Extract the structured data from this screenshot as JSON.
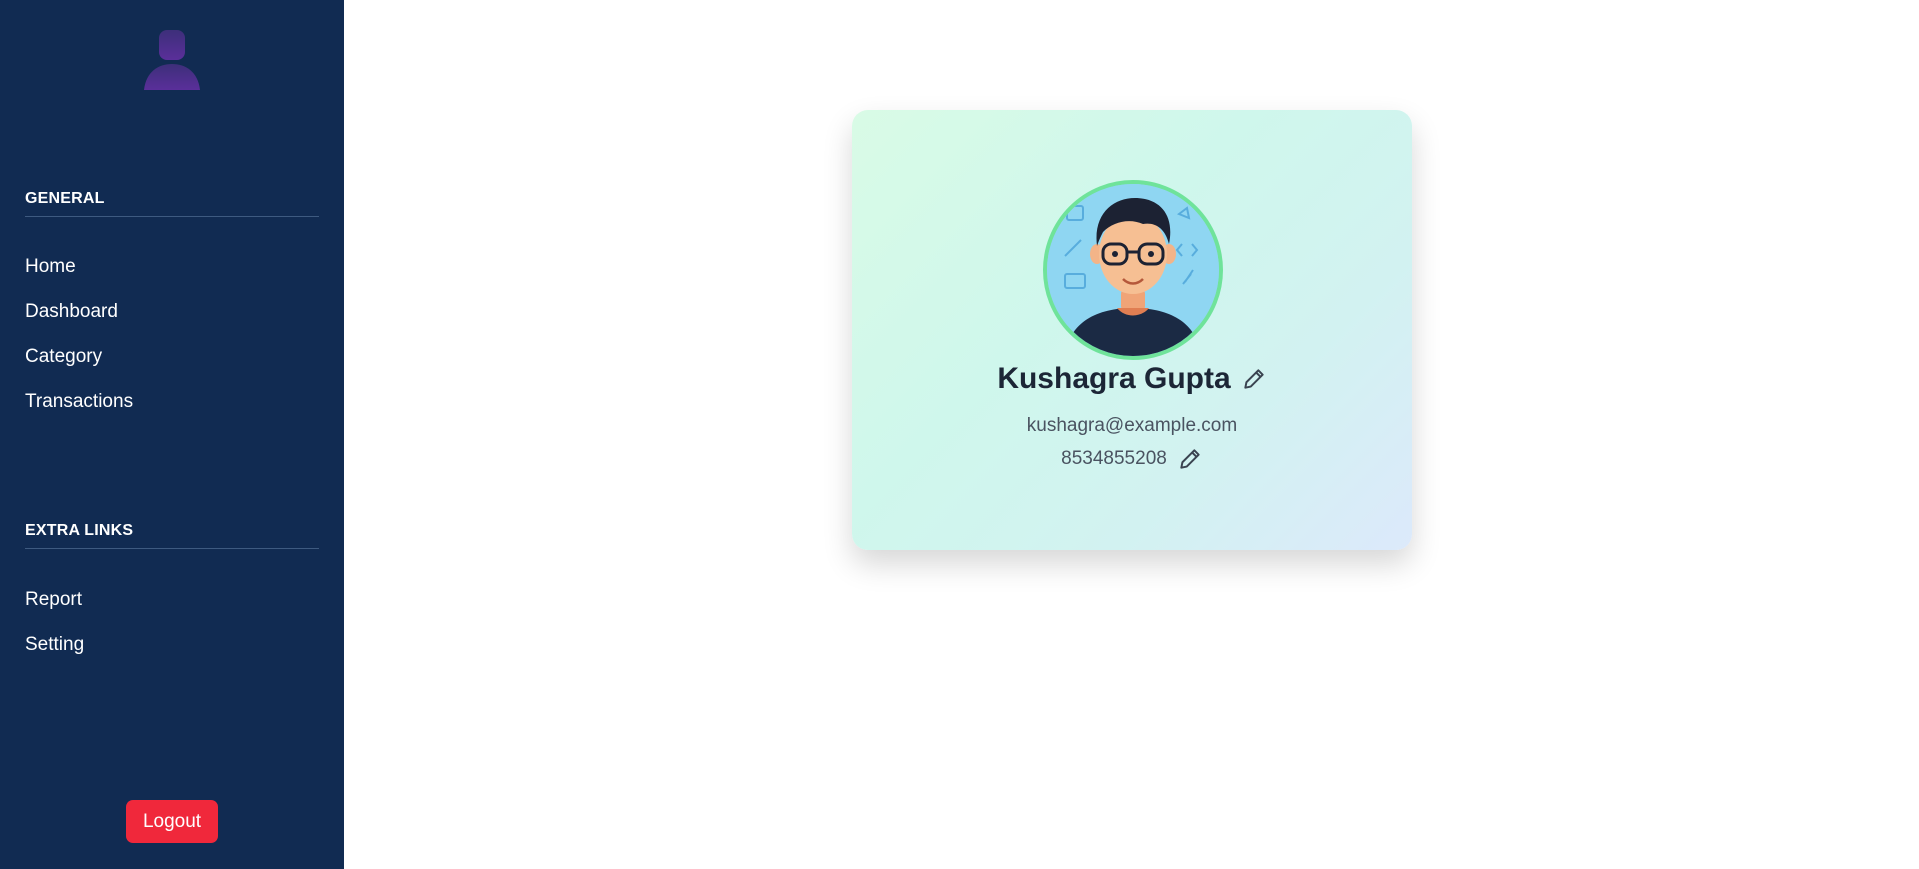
{
  "sidebar": {
    "sections": [
      {
        "title": "GENERAL",
        "items": [
          {
            "label": "Home"
          },
          {
            "label": "Dashboard"
          },
          {
            "label": "Category"
          },
          {
            "label": "Transactions"
          }
        ]
      },
      {
        "title": "EXTRA LINKS",
        "items": [
          {
            "label": "Report"
          },
          {
            "label": "Setting"
          }
        ]
      }
    ],
    "logout_label": "Logout",
    "avatar_icon": "user-silhouette-icon"
  },
  "profile": {
    "name": "Kushagra Gupta",
    "email": "kushagra@example.com",
    "phone": "8534855208",
    "edit_icon": "pencil-icon"
  },
  "colors": {
    "sidebar_bg": "#112b52",
    "logout_bg": "#f0283b",
    "avatar_ring": "#6fe39a",
    "card_gradient_start": "#d9fbe6",
    "card_gradient_end": "#dce9fb"
  }
}
